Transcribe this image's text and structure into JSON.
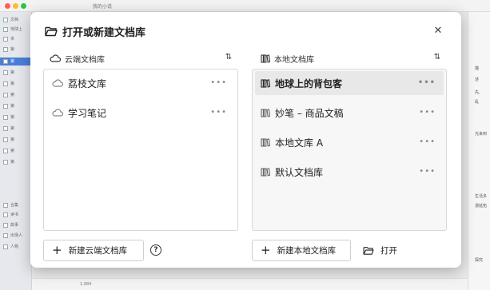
{
  "background": {
    "window_title": "我的小说",
    "sidebar_items": [
      "文档",
      "地球上",
      "米",
      "第",
      "第",
      "第",
      "第",
      "第",
      "第",
      "第",
      "第",
      "第",
      "第",
      "第",
      "合集",
      "读书",
      "故事",
      "出场人",
      "人物"
    ],
    "right_snippets": [
      "描",
      "述",
      "先,",
      "乱",
      "光来到",
      "生活多",
      "漫延拓",
      "探究"
    ],
    "status": "1,984"
  },
  "dialog": {
    "title": "打开或新建文档库",
    "cloud": {
      "header": "云端文档库",
      "items": [
        {
          "label": "荔枝文库",
          "more": "•••"
        },
        {
          "label": "学习笔记",
          "more": "•••"
        }
      ],
      "new_button": "新建云端文档库",
      "help": "?"
    },
    "local": {
      "header": "本地文档库",
      "items": [
        {
          "label": "地球上的背包客",
          "more": "•••",
          "selected": true
        },
        {
          "label": "妙笔 – 商品文稿",
          "more": "•••"
        },
        {
          "label": "本地文库 A",
          "more": "•••"
        },
        {
          "label": "默认文档库",
          "more": "•••"
        }
      ],
      "new_button": "新建本地文档库",
      "open_button": "打开"
    },
    "sort_symbol": "⇅",
    "close_symbol": "✕"
  },
  "colors": {
    "accent": "#4a7fd8",
    "selected_row": "#e8e8e8"
  }
}
